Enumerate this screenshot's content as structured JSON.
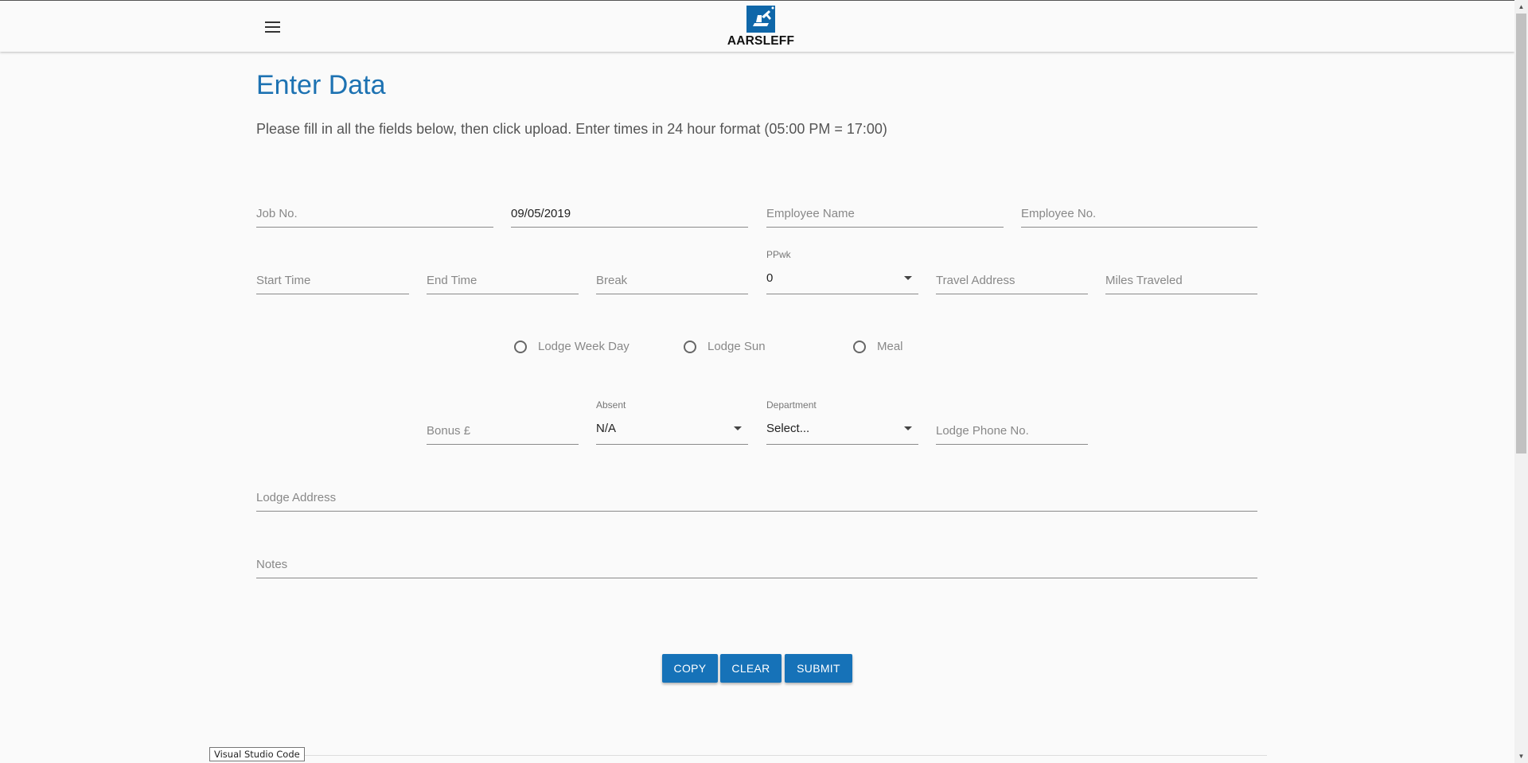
{
  "header": {
    "brand": "AARSLEFF",
    "menu_icon": "hamburger-menu-icon"
  },
  "page": {
    "title": "Enter Data",
    "instructions": "Please fill in all the fields below, then click upload. Enter times in 24 hour format (05:00 PM = 17:00)"
  },
  "form": {
    "job_no": {
      "placeholder": "Job No.",
      "value": ""
    },
    "date": {
      "placeholder": "",
      "value": "09/05/2019"
    },
    "employee_name": {
      "placeholder": "Employee Name",
      "value": ""
    },
    "employee_no": {
      "placeholder": "Employee No.",
      "value": ""
    },
    "start_time": {
      "placeholder": "Start Time",
      "value": ""
    },
    "end_time": {
      "placeholder": "End Time",
      "value": ""
    },
    "break": {
      "placeholder": "Break",
      "value": ""
    },
    "ppwk": {
      "label": "PPwk",
      "value": "0"
    },
    "travel_address": {
      "placeholder": "Travel Address",
      "value": ""
    },
    "miles_traveled": {
      "placeholder": "Miles Traveled",
      "value": ""
    },
    "radios": {
      "lodge_week_day": "Lodge Week Day",
      "lodge_sun": "Lodge Sun",
      "meal": "Meal"
    },
    "bonus": {
      "placeholder": "Bonus £",
      "value": ""
    },
    "absent": {
      "label": "Absent",
      "value": "N/A"
    },
    "department": {
      "label": "Department",
      "value": "Select..."
    },
    "lodge_phone": {
      "placeholder": "Lodge Phone No.",
      "value": ""
    },
    "lodge_address": {
      "placeholder": "Lodge Address",
      "value": ""
    },
    "notes": {
      "placeholder": "Notes",
      "value": ""
    }
  },
  "actions": {
    "copy": "COPY",
    "clear": "CLEAR",
    "submit": "SUBMIT"
  },
  "tooltip": "Visual Studio Code",
  "colors": {
    "accent": "#1672b8",
    "title": "#1d72b2",
    "logo": "#0f67a9"
  }
}
